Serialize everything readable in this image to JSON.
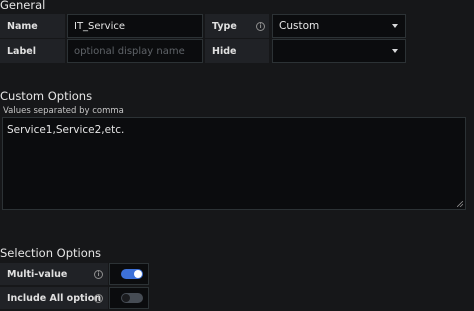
{
  "general": {
    "title": "General",
    "name_label": "Name",
    "name_value": "IT_Service",
    "type_label": "Type",
    "type_value": "Custom",
    "label_label": "Label",
    "label_placeholder": "optional display name",
    "hide_label": "Hide",
    "hide_value": ""
  },
  "custom_options": {
    "title": "Custom Options",
    "hint": "Values separated by comma",
    "value": "Service1,Service2,etc."
  },
  "selection_options": {
    "title": "Selection Options",
    "multi_value_label": "Multi-value",
    "multi_value": true,
    "include_all_label": "Include All option",
    "include_all": false
  },
  "colors": {
    "toggle_on": "#3d71d9",
    "toggle_off": "#464c54"
  }
}
